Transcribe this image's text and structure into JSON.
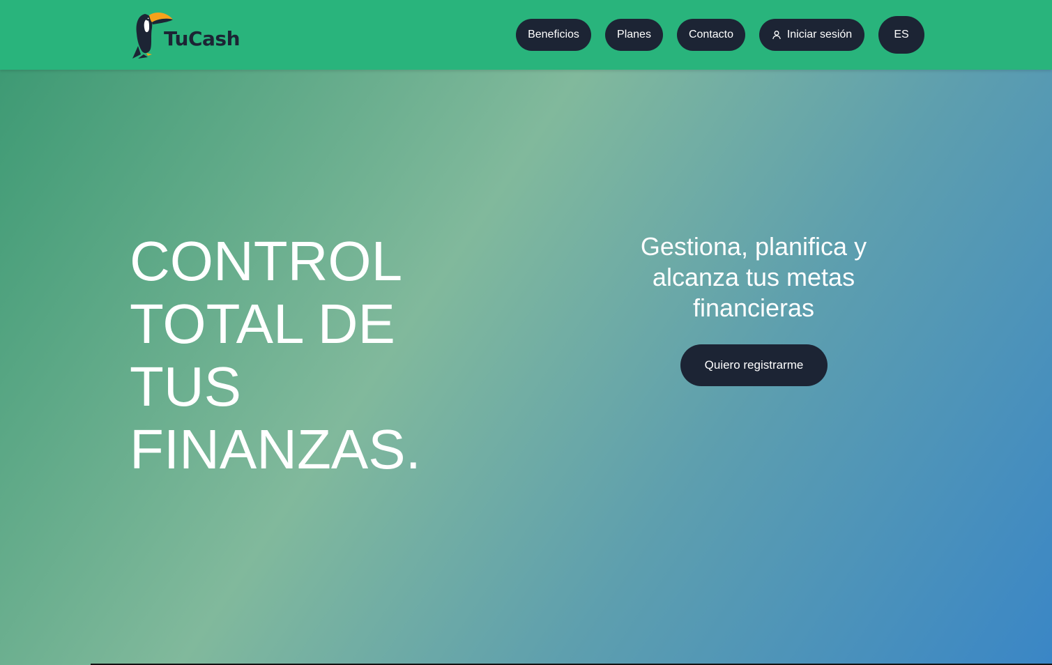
{
  "brand": {
    "name": "TuCash",
    "logo_icon": "toucan-icon",
    "primary_color": "#29b47c",
    "dark_color": "#1c2434",
    "beak_color": "#f7a21b"
  },
  "nav": {
    "items": [
      {
        "label": "Beneficios"
      },
      {
        "label": "Planes"
      },
      {
        "label": "Contacto"
      }
    ],
    "login": {
      "label": "Iniciar sesión",
      "icon": "user-icon"
    },
    "language": {
      "label": "ES"
    }
  },
  "hero": {
    "headline": "CONTROL TOTAL DE TUS FINANZAS.",
    "tagline": "Gestiona, planifica y alcanza tus metas financieras",
    "cta_label": "Quiero registrarme",
    "gradient_colors": [
      "#3e9a74",
      "#81b99c",
      "#3a86c6"
    ]
  }
}
